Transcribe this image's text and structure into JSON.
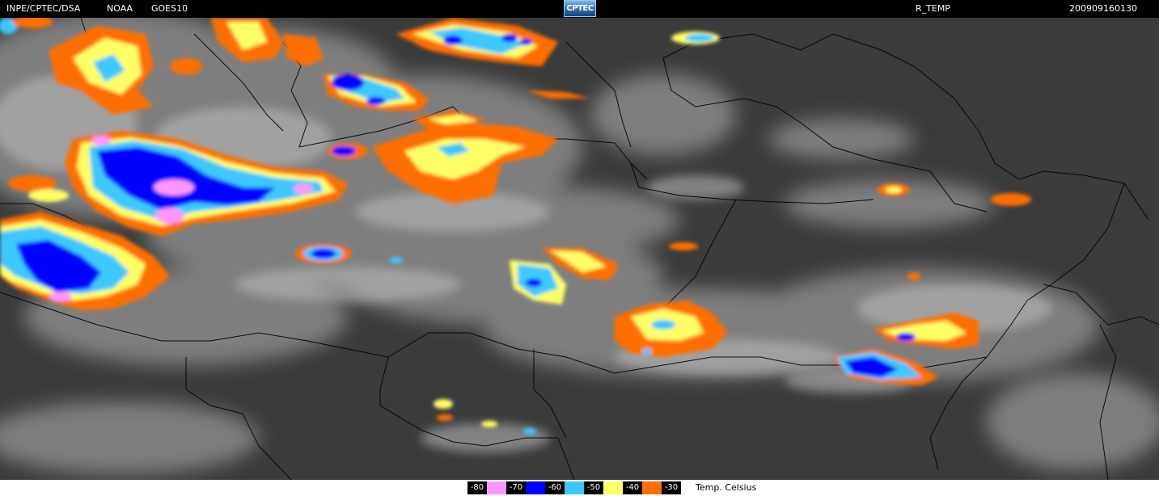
{
  "header": {
    "institution": "INPE/CPTEC/DSA",
    "agency": "NOAA",
    "satellite": "GOES10",
    "logo_text": "CPTEC",
    "product": "R_TEMP",
    "datetime": "200909160130"
  },
  "map": {
    "background_color": "#3a3a3a",
    "border_color": "#000000"
  },
  "legend": {
    "unit_label": "Temp. Celsius",
    "items": [
      {
        "label": "-80",
        "color": "#000000"
      },
      {
        "label": "-70",
        "color": "#ff96ff"
      },
      {
        "label": "-60",
        "color": "#0000ff"
      },
      {
        "label": "-50",
        "color": "#3cc8ff"
      },
      {
        "label": "-40",
        "color": "#ffff66"
      },
      {
        "label": "-30",
        "color": "#ff6e00"
      }
    ]
  }
}
